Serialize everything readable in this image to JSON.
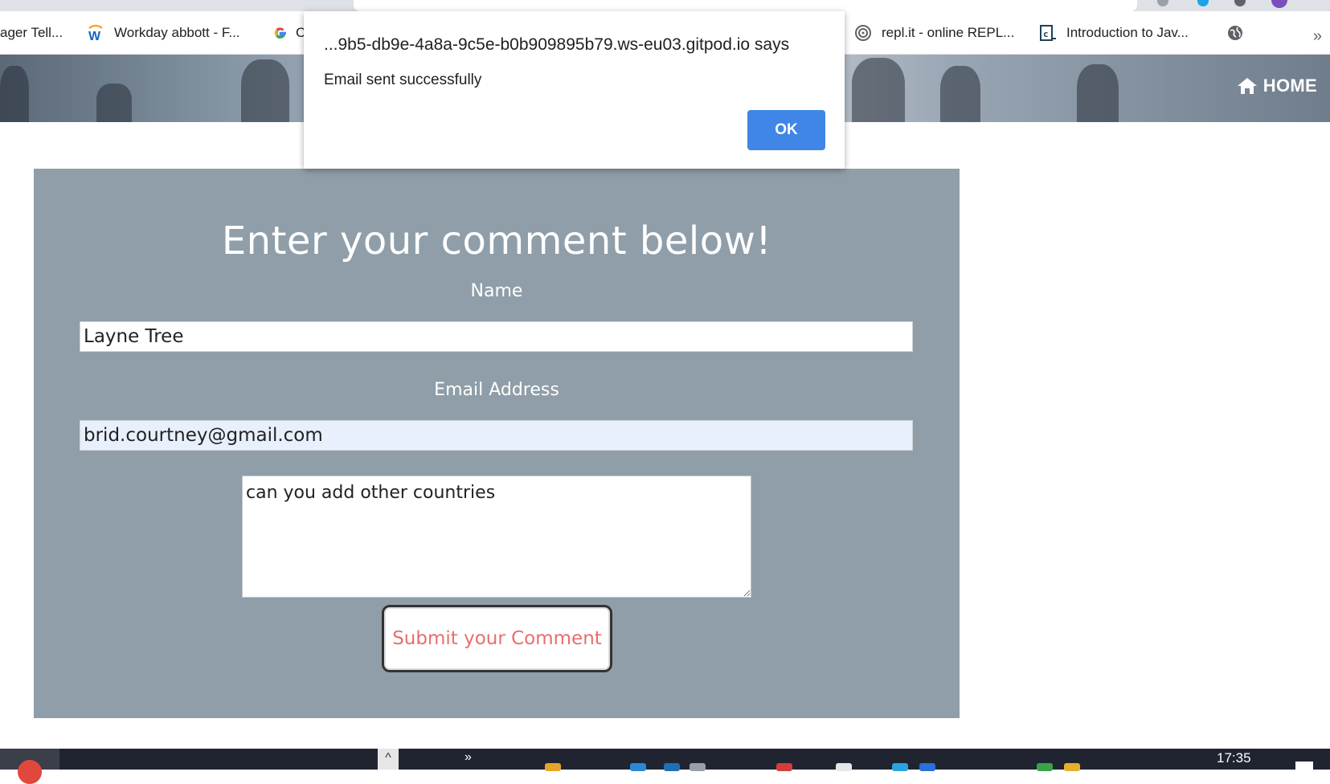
{
  "bookmarks": [
    {
      "label": "ager Tell...",
      "icon": "bookmark-icon"
    },
    {
      "label": "Workday abbott - F...",
      "icon": "workday-icon"
    },
    {
      "label": "C",
      "icon": "google-icon"
    },
    {
      "label": "repl.it - online REPL...",
      "icon": "replit-icon"
    },
    {
      "label": "Introduction to Jav...",
      "icon": "codecademy-icon"
    }
  ],
  "bookmarks_more": "»",
  "header": {
    "home_label": "HOME"
  },
  "form": {
    "title": "Enter your comment below!",
    "name_label": "Name",
    "name_value": "Layne Tree",
    "email_label": "Email Address",
    "email_value": "brid.courtney@gmail.com",
    "comment_value": "can you add other countries",
    "submit_label": "Submit your Comment"
  },
  "dialog": {
    "origin": "...9b5-db9e-4a8a-9c5e-b0b909895b79.ws-eu03.gitpod.io says",
    "message": "Email sent successfully",
    "ok_label": "OK"
  },
  "taskbar": {
    "clock": "17:35",
    "chevron": "»",
    "caret": "^"
  },
  "colors": {
    "panel": "#8f9ea8",
    "submit_text": "#e86e6e",
    "ok_button": "#3f86e6",
    "autofill": "#e8f0fe"
  }
}
